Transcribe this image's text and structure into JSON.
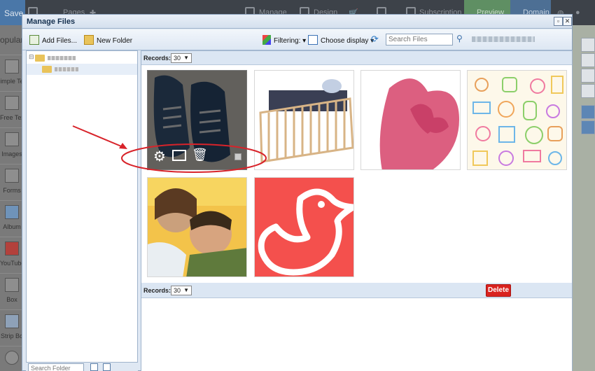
{
  "topbar": {
    "save": "Save",
    "pages": "Pages",
    "manage": "Manage",
    "design": "Design",
    "subscription": "Subscription",
    "preview": "Preview",
    "domain": "Domain"
  },
  "palette": {
    "popular": "opular",
    "items": [
      "imple Te",
      "Free Tex",
      "Images",
      "Forms",
      "Album",
      "YouTube",
      "Box",
      "Strip Bo"
    ]
  },
  "modal": {
    "title": "Manage Files",
    "toolbar": {
      "add_files": "Add Files...",
      "new_folder": "New Folder",
      "filtering": "Filtering:",
      "choose_display": "Choose display",
      "search_placeholder": "Search Files"
    },
    "tree": {
      "search_placeholder": "Search Folder"
    },
    "records_label": "Records:",
    "records_value": "30",
    "delete_label": "Delete"
  },
  "colors": {
    "accent": "#4a77a8",
    "delete": "#d9231f",
    "duck_bg": "#f4504d",
    "annotation": "#d8232a"
  }
}
